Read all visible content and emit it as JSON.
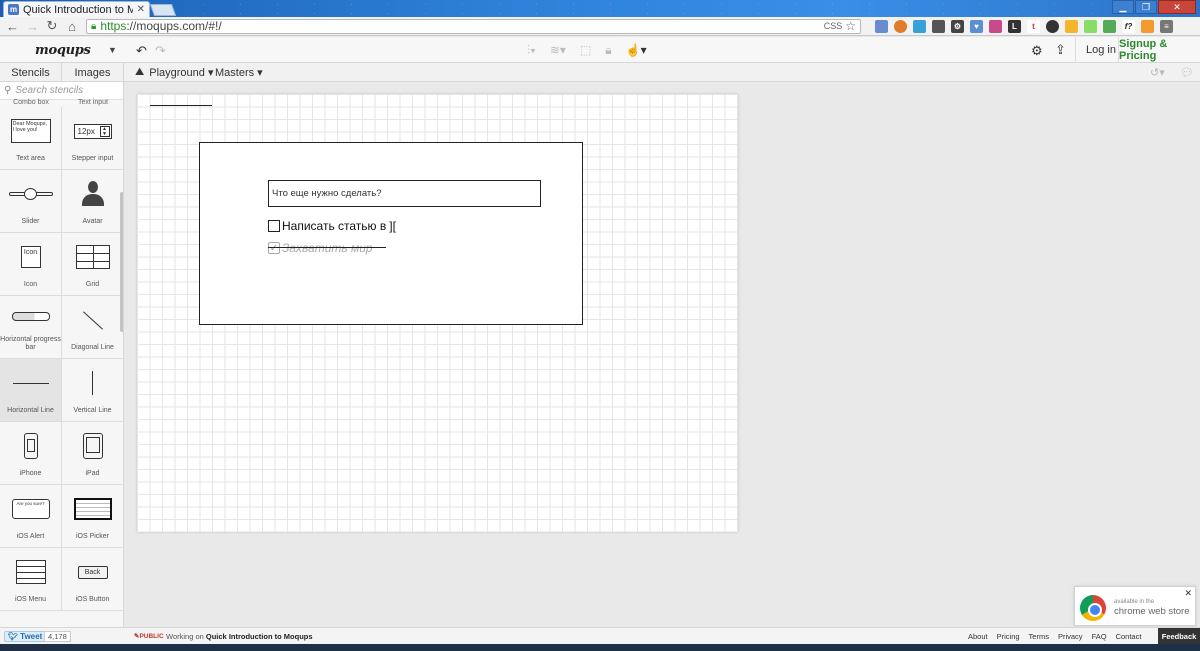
{
  "browser": {
    "tab_title": "Quick Introduction to Moqups",
    "tab_favicon": "m",
    "url_scheme": "https",
    "url_rest": "://moqups.com/#!/",
    "omnibox_badge": "CSS"
  },
  "app": {
    "logo": "moqups",
    "login_label": "Log in",
    "signup_label": "Signup & Pricing"
  },
  "subbar": {
    "tab_stencils": "Stencils",
    "tab_images": "Images",
    "playground": "Playground ▾",
    "masters": "Masters ▾"
  },
  "sidebar": {
    "search_placeholder": "Search stencils",
    "partial_labels": [
      "Combo box",
      "Text input"
    ],
    "stencils": [
      {
        "label": "Text area",
        "icon": "textarea-icon",
        "preview": "Dear Moqups, I love you!"
      },
      {
        "label": "Stepper input",
        "icon": "stepper-icon",
        "preview": "12px"
      },
      {
        "label": "Slider",
        "icon": "slider-icon"
      },
      {
        "label": "Avatar",
        "icon": "avatar-icon"
      },
      {
        "label": "Icon",
        "icon": "icon-stencil-icon",
        "preview": "Icon"
      },
      {
        "label": "Grid",
        "icon": "grid-icon"
      },
      {
        "label": "Horizontal progress bar",
        "icon": "progress-icon"
      },
      {
        "label": "Diagonal Line",
        "icon": "diagonal-line-icon"
      },
      {
        "label": "Horizontal Line",
        "icon": "horizontal-line-icon"
      },
      {
        "label": "Vertical Line",
        "icon": "vertical-line-icon"
      },
      {
        "label": "iPhone",
        "icon": "iphone-icon"
      },
      {
        "label": "iPad",
        "icon": "ipad-icon"
      },
      {
        "label": "iOS Alert",
        "icon": "ios-alert-icon",
        "preview": "Are you sure?"
      },
      {
        "label": "iOS Picker",
        "icon": "ios-picker-icon"
      },
      {
        "label": "iOS Menu",
        "icon": "ios-menu-icon"
      },
      {
        "label": "iOS Button",
        "icon": "ios-button-icon",
        "preview": "Back"
      }
    ]
  },
  "canvas": {
    "todo_placeholder": "Что еще нужно сделать?",
    "todo_active": "Написать статью в ",
    "todo_cursor": "][",
    "todo_done": "Захватить мир"
  },
  "notification": {
    "small": "available in the",
    "big": "chrome web store"
  },
  "footer": {
    "tweet_label": "Tweet",
    "tweet_count": "4,178",
    "public_badge": "PUBLIC",
    "working_prefix": "Working on",
    "working_project": "Quick Introduction to Moqups",
    "links": [
      "About",
      "Pricing",
      "Terms",
      "Privacy",
      "FAQ",
      "Contact"
    ],
    "feedback": "Feedback"
  }
}
